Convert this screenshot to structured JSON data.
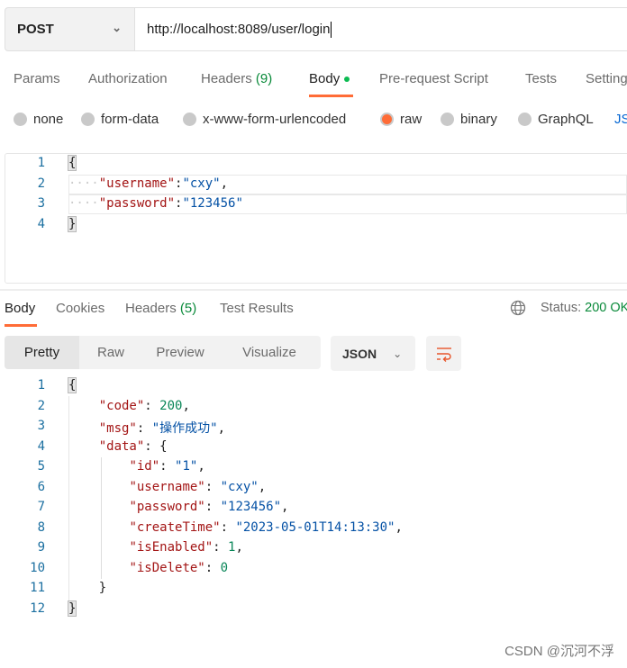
{
  "request": {
    "method": "POST",
    "url": "http://localhost:8089/user/login"
  },
  "request_tabs": [
    {
      "label": "Params"
    },
    {
      "label": "Authorization"
    },
    {
      "label": "Headers",
      "count": "(9)"
    },
    {
      "label": "Body",
      "active": true
    },
    {
      "label": "Pre-request Script"
    },
    {
      "label": "Tests"
    },
    {
      "label": "Settings"
    }
  ],
  "body_modes": [
    {
      "label": "none"
    },
    {
      "label": "form-data"
    },
    {
      "label": "x-www-form-urlencoded"
    },
    {
      "label": "raw",
      "selected": true
    },
    {
      "label": "binary"
    },
    {
      "label": "GraphQL"
    },
    {
      "label": "JSON"
    }
  ],
  "request_body": [
    [
      [
        "p",
        "{"
      ]
    ],
    [
      [
        "ws",
        "····"
      ],
      [
        "k",
        "\"username\""
      ],
      [
        "p",
        ":"
      ],
      [
        "s",
        "\"cxy\""
      ],
      [
        "p",
        ","
      ]
    ],
    [
      [
        "ws",
        "····"
      ],
      [
        "k",
        "\"password\""
      ],
      [
        "p",
        ":"
      ],
      [
        "s",
        "\"123456\""
      ]
    ],
    [
      [
        "p",
        "}"
      ]
    ]
  ],
  "response_tabs": [
    {
      "label": "Body",
      "active": true
    },
    {
      "label": "Cookies"
    },
    {
      "label": "Headers",
      "count": "(5)"
    },
    {
      "label": "Test Results"
    }
  ],
  "status": {
    "label": "Status:",
    "value": "200 OK",
    "color": "#0a8a3a"
  },
  "view_modes": [
    "Pretty",
    "Raw",
    "Preview",
    "Visualize"
  ],
  "format": "JSON",
  "response_body": [
    [
      [
        "p",
        "{"
      ]
    ],
    [
      [
        "p",
        "    "
      ],
      [
        "k",
        "\"code\""
      ],
      [
        "p",
        ": "
      ],
      [
        "n",
        "200"
      ],
      [
        "p",
        ","
      ]
    ],
    [
      [
        "p",
        "    "
      ],
      [
        "k",
        "\"msg\""
      ],
      [
        "p",
        ": "
      ],
      [
        "s",
        "\"操作成功\""
      ],
      [
        "p",
        ","
      ]
    ],
    [
      [
        "p",
        "    "
      ],
      [
        "k",
        "\"data\""
      ],
      [
        "p",
        ": {"
      ]
    ],
    [
      [
        "p",
        "        "
      ],
      [
        "k",
        "\"id\""
      ],
      [
        "p",
        ": "
      ],
      [
        "s",
        "\"1\""
      ],
      [
        "p",
        ","
      ]
    ],
    [
      [
        "p",
        "        "
      ],
      [
        "k",
        "\"username\""
      ],
      [
        "p",
        ": "
      ],
      [
        "s",
        "\"cxy\""
      ],
      [
        "p",
        ","
      ]
    ],
    [
      [
        "p",
        "        "
      ],
      [
        "k",
        "\"password\""
      ],
      [
        "p",
        ": "
      ],
      [
        "s",
        "\"123456\""
      ],
      [
        "p",
        ","
      ]
    ],
    [
      [
        "p",
        "        "
      ],
      [
        "k",
        "\"createTime\""
      ],
      [
        "p",
        ": "
      ],
      [
        "s",
        "\"2023-05-01T14:13:30\""
      ],
      [
        "p",
        ","
      ]
    ],
    [
      [
        "p",
        "        "
      ],
      [
        "k",
        "\"isEnabled\""
      ],
      [
        "p",
        ": "
      ],
      [
        "n",
        "1"
      ],
      [
        "p",
        ","
      ]
    ],
    [
      [
        "p",
        "        "
      ],
      [
        "k",
        "\"isDelete\""
      ],
      [
        "p",
        ": "
      ],
      [
        "n",
        "0"
      ]
    ],
    [
      [
        "p",
        "    }"
      ]
    ],
    [
      [
        "p",
        "}"
      ]
    ]
  ],
  "accent": "#ff6c37",
  "watermark": "CSDN @沉河不浮"
}
